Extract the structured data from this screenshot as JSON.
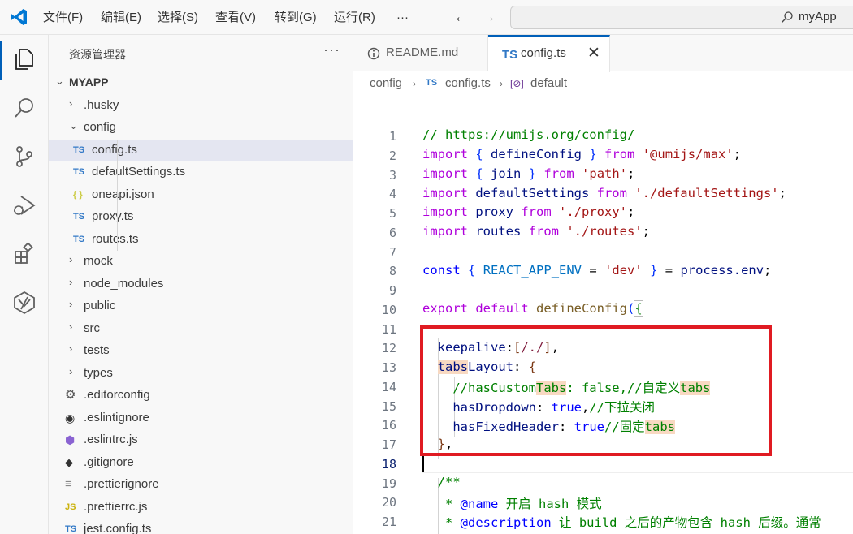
{
  "titlebar": {
    "menus": [
      "文件(F)",
      "编辑(E)",
      "选择(S)",
      "查看(V)",
      "转到(G)",
      "运行(R)",
      "···"
    ],
    "search_text": "myApp"
  },
  "activitybar": {
    "icons": [
      "explorer-icon",
      "search-icon",
      "source-control-icon",
      "run-debug-icon",
      "extensions-icon",
      "remote-icon"
    ]
  },
  "explorer": {
    "header": "资源管理器",
    "more": "···",
    "root": "MYAPP",
    "items": [
      {
        "label": ".husky",
        "type": "folder",
        "expanded": false
      },
      {
        "label": "config",
        "type": "folder",
        "expanded": true
      },
      {
        "label": "config.ts",
        "type": "ts",
        "selected": true
      },
      {
        "label": "defaultSettings.ts",
        "type": "ts"
      },
      {
        "label": "oneapi.json",
        "type": "json"
      },
      {
        "label": "proxy.ts",
        "type": "ts"
      },
      {
        "label": "routes.ts",
        "type": "ts"
      },
      {
        "label": "mock",
        "type": "folder",
        "expanded": false
      },
      {
        "label": "node_modules",
        "type": "folder",
        "expanded": false
      },
      {
        "label": "public",
        "type": "folder",
        "expanded": false
      },
      {
        "label": "src",
        "type": "folder",
        "expanded": false
      },
      {
        "label": "tests",
        "type": "folder",
        "expanded": false
      },
      {
        "label": "types",
        "type": "folder",
        "expanded": false
      },
      {
        "label": ".editorconfig",
        "type": "gear"
      },
      {
        "label": ".eslintignore",
        "type": "eslint"
      },
      {
        "label": ".eslintrc.js",
        "type": "eslintjs"
      },
      {
        "label": ".gitignore",
        "type": "git"
      },
      {
        "label": ".prettierignore",
        "type": "lines"
      },
      {
        "label": ".prettierrc.js",
        "type": "js"
      },
      {
        "label": "jest.config.ts",
        "type": "ts"
      }
    ],
    "badge_ts": "TS",
    "badge_json": "{ }",
    "badge_js": "JS"
  },
  "tabs": [
    {
      "label": "README.md",
      "icon": "info-icon",
      "active": false
    },
    {
      "label": "config.ts",
      "icon": "TS",
      "active": true
    }
  ],
  "breadcrumb": [
    "config",
    "config.ts",
    "default"
  ],
  "editor": {
    "current_line": 18,
    "line_numbers": [
      "1",
      "2",
      "3",
      "4",
      "5",
      "6",
      "7",
      "8",
      "9",
      "10",
      "11",
      "12",
      "13",
      "14",
      "15",
      "16",
      "17",
      "18",
      "19",
      "20",
      "21"
    ]
  }
}
